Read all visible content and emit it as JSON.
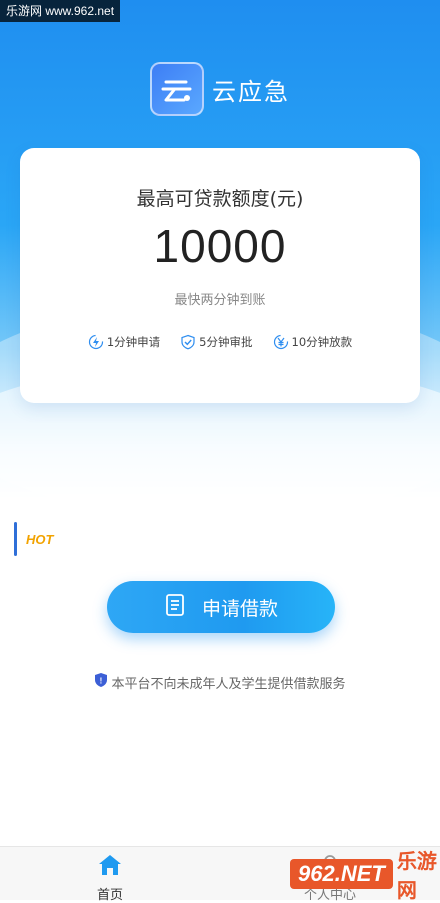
{
  "watermark": "乐游网 www.962.net",
  "brand": {
    "name": "云应急",
    "icon": "cloud-logo-icon"
  },
  "card": {
    "label": "最高可贷款额度(元)",
    "amount": "10000",
    "speed": "最快两分钟到账",
    "features": [
      {
        "icon": "lightning-icon",
        "label": "1分钟申请"
      },
      {
        "icon": "shield-check-icon",
        "label": "5分钟审批"
      },
      {
        "icon": "yen-icon",
        "label": "10分钟放款"
      }
    ]
  },
  "hot": {
    "label": "HOT"
  },
  "apply": {
    "label": "申请借款",
    "icon": "document-icon"
  },
  "notice": {
    "text": "本平台不向未成年人及学生提供借款服务",
    "icon": "shield-icon"
  },
  "tabs": [
    {
      "label": "首页",
      "icon": "home-icon",
      "active": true
    },
    {
      "label": "个人中心",
      "icon": "user-icon",
      "active": false
    }
  ],
  "corner_badge": {
    "part1": "962.NET",
    "part2": "乐游网"
  },
  "colors": {
    "primary": "#1f9af0",
    "hot": "#f2a300",
    "accent_bar": "#2f6fd8"
  }
}
